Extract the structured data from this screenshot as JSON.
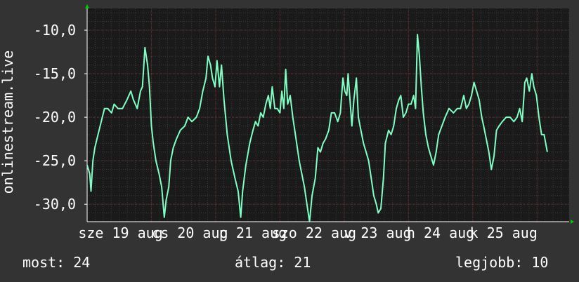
{
  "colors": {
    "background": "#333333",
    "plot_background": "#1a1a1a",
    "grid_minor": "#3a3a3a",
    "grid_major_x": "#6b2a2a",
    "grid_major_y": "#5a3030",
    "line": "#7fffc4",
    "axis_arrow": "#00cc00",
    "text": "#ffffff"
  },
  "stats": {
    "now_label": "most:",
    "now_value": "24",
    "avg_label": "átlag:",
    "avg_value": "21",
    "best_label": "legjobb:",
    "best_value": "10"
  },
  "chart_data": {
    "type": "line",
    "title": "",
    "ylabel": "onlinestream.live",
    "xlabel": "",
    "ylim": [
      -32,
      -7.5
    ],
    "y_ticks": [
      -10,
      -15,
      -20,
      -25,
      -30
    ],
    "y_tick_labels": [
      "-10,0",
      "-15,0",
      "-20,0",
      "-25,0",
      "-30,0"
    ],
    "xlim": [
      0,
      7.5
    ],
    "x_tick_labels": [
      {
        "label": "sze 19 aug",
        "x": 0.52
      },
      {
        "label": "cs 20 aug",
        "x": 1.6
      },
      {
        "label": "p 21 aug",
        "x": 2.58
      },
      {
        "label": "szo 22 aug",
        "x": 3.53
      },
      {
        "label": "v 23 aug",
        "x": 4.52
      },
      {
        "label": "h 24 aug",
        "x": 5.5
      },
      {
        "label": "k 25 aug",
        "x": 6.48
      }
    ],
    "grid": true,
    "series": [
      {
        "values": [
          [
            0.0,
            -25.5
          ],
          [
            0.04,
            -26.5
          ],
          [
            0.06,
            -28.5
          ],
          [
            0.09,
            -25
          ],
          [
            0.12,
            -23.5
          ],
          [
            0.17,
            -22
          ],
          [
            0.22,
            -20.5
          ],
          [
            0.27,
            -19
          ],
          [
            0.32,
            -19
          ],
          [
            0.38,
            -19.5
          ],
          [
            0.42,
            -18.5
          ],
          [
            0.48,
            -19
          ],
          [
            0.55,
            -19
          ],
          [
            0.62,
            -18
          ],
          [
            0.68,
            -17
          ],
          [
            0.72,
            -18
          ],
          [
            0.78,
            -19
          ],
          [
            0.83,
            -17
          ],
          [
            0.86,
            -16.5
          ],
          [
            0.9,
            -12
          ],
          [
            0.94,
            -14
          ],
          [
            0.97,
            -16.5
          ],
          [
            1.0,
            -21
          ],
          [
            1.03,
            -23
          ],
          [
            1.07,
            -25
          ],
          [
            1.12,
            -26.5
          ],
          [
            1.16,
            -28
          ],
          [
            1.2,
            -31.5
          ],
          [
            1.23,
            -29.5
          ],
          [
            1.27,
            -28
          ],
          [
            1.3,
            -25
          ],
          [
            1.34,
            -23.5
          ],
          [
            1.39,
            -22.5
          ],
          [
            1.45,
            -21.5
          ],
          [
            1.52,
            -21
          ],
          [
            1.57,
            -20
          ],
          [
            1.63,
            -20.5
          ],
          [
            1.7,
            -20
          ],
          [
            1.75,
            -19
          ],
          [
            1.8,
            -17
          ],
          [
            1.85,
            -15.5
          ],
          [
            1.88,
            -13
          ],
          [
            1.92,
            -14
          ],
          [
            1.95,
            -15.5
          ],
          [
            1.99,
            -16.5
          ],
          [
            2.02,
            -13.5
          ],
          [
            2.06,
            -16.5
          ],
          [
            2.09,
            -14
          ],
          [
            2.13,
            -18
          ],
          [
            2.18,
            -22
          ],
          [
            2.24,
            -25
          ],
          [
            2.3,
            -27
          ],
          [
            2.35,
            -28.5
          ],
          [
            2.39,
            -31.5
          ],
          [
            2.42,
            -28.5
          ],
          [
            2.47,
            -25.5
          ],
          [
            2.53,
            -23
          ],
          [
            2.58,
            -21.5
          ],
          [
            2.62,
            -20.5
          ],
          [
            2.66,
            -21
          ],
          [
            2.7,
            -19.5
          ],
          [
            2.74,
            -20
          ],
          [
            2.78,
            -18.5
          ],
          [
            2.82,
            -17.5
          ],
          [
            2.85,
            -19
          ],
          [
            2.88,
            -16.5
          ],
          [
            2.92,
            -19
          ],
          [
            2.96,
            -19
          ],
          [
            3.0,
            -19.5
          ],
          [
            3.03,
            -17
          ],
          [
            3.06,
            -19
          ],
          [
            3.09,
            -14.5
          ],
          [
            3.12,
            -18.5
          ],
          [
            3.16,
            -17.5
          ],
          [
            3.2,
            -20
          ],
          [
            3.25,
            -22.5
          ],
          [
            3.3,
            -25
          ],
          [
            3.34,
            -26.5
          ],
          [
            3.38,
            -28
          ],
          [
            3.42,
            -30
          ],
          [
            3.46,
            -32
          ],
          [
            3.5,
            -29
          ],
          [
            3.55,
            -27
          ],
          [
            3.59,
            -23.5
          ],
          [
            3.63,
            -24
          ],
          [
            3.67,
            -23
          ],
          [
            3.71,
            -22.5
          ],
          [
            3.76,
            -21.5
          ],
          [
            3.8,
            -19.5
          ],
          [
            3.85,
            -19.5
          ],
          [
            3.9,
            -20.5
          ],
          [
            3.94,
            -19.5
          ],
          [
            3.98,
            -15.5
          ],
          [
            4.01,
            -17
          ],
          [
            4.04,
            -17.5
          ],
          [
            4.06,
            -15
          ],
          [
            4.09,
            -18
          ],
          [
            4.12,
            -21
          ],
          [
            4.15,
            -18
          ],
          [
            4.19,
            -15.5
          ],
          [
            4.22,
            -20
          ],
          [
            4.26,
            -21.5
          ],
          [
            4.3,
            -23
          ],
          [
            4.34,
            -24
          ],
          [
            4.38,
            -25
          ],
          [
            4.42,
            -27
          ],
          [
            4.46,
            -29
          ],
          [
            4.5,
            -30
          ],
          [
            4.53,
            -31
          ],
          [
            4.57,
            -30.5
          ],
          [
            4.61,
            -27
          ],
          [
            4.64,
            -23
          ],
          [
            4.69,
            -21.5
          ],
          [
            4.73,
            -22
          ],
          [
            4.77,
            -21
          ],
          [
            4.81,
            -19
          ],
          [
            4.85,
            -18
          ],
          [
            4.88,
            -17.5
          ],
          [
            4.92,
            -20
          ],
          [
            4.96,
            -19.5
          ],
          [
            5.0,
            -18.5
          ],
          [
            5.04,
            -18.5
          ],
          [
            5.08,
            -17.5
          ],
          [
            5.11,
            -19
          ],
          [
            5.14,
            -10.5
          ],
          [
            5.17,
            -13
          ],
          [
            5.2,
            -16.5
          ],
          [
            5.23,
            -19.5
          ],
          [
            5.27,
            -22
          ],
          [
            5.31,
            -23.5
          ],
          [
            5.35,
            -24.5
          ],
          [
            5.39,
            -25.5
          ],
          [
            5.43,
            -24
          ],
          [
            5.47,
            -22
          ],
          [
            5.52,
            -21
          ],
          [
            5.57,
            -20
          ],
          [
            5.63,
            -19
          ],
          [
            5.7,
            -19.5
          ],
          [
            5.76,
            -19
          ],
          [
            5.81,
            -19
          ],
          [
            5.86,
            -17.5
          ],
          [
            5.9,
            -19
          ],
          [
            5.94,
            -18.5
          ],
          [
            5.98,
            -17.5
          ],
          [
            6.02,
            -16
          ],
          [
            6.06,
            -17
          ],
          [
            6.1,
            -18
          ],
          [
            6.14,
            -20
          ],
          [
            6.17,
            -21
          ],
          [
            6.21,
            -22.5
          ],
          [
            6.25,
            -24
          ],
          [
            6.29,
            -26
          ],
          [
            6.33,
            -24.5
          ],
          [
            6.37,
            -21.5
          ],
          [
            6.41,
            -21
          ],
          [
            6.46,
            -20.5
          ],
          [
            6.52,
            -20
          ],
          [
            6.58,
            -20
          ],
          [
            6.64,
            -20.5
          ],
          [
            6.69,
            -20
          ],
          [
            6.73,
            -19
          ],
          [
            6.77,
            -20.5
          ],
          [
            6.81,
            -16
          ],
          [
            6.84,
            -15.5
          ],
          [
            6.88,
            -17
          ],
          [
            6.92,
            -15
          ],
          [
            6.95,
            -16.5
          ],
          [
            6.99,
            -17.5
          ],
          [
            7.03,
            -20
          ],
          [
            7.07,
            -22
          ],
          [
            7.11,
            -22
          ],
          [
            7.16,
            -24
          ]
        ]
      }
    ]
  }
}
